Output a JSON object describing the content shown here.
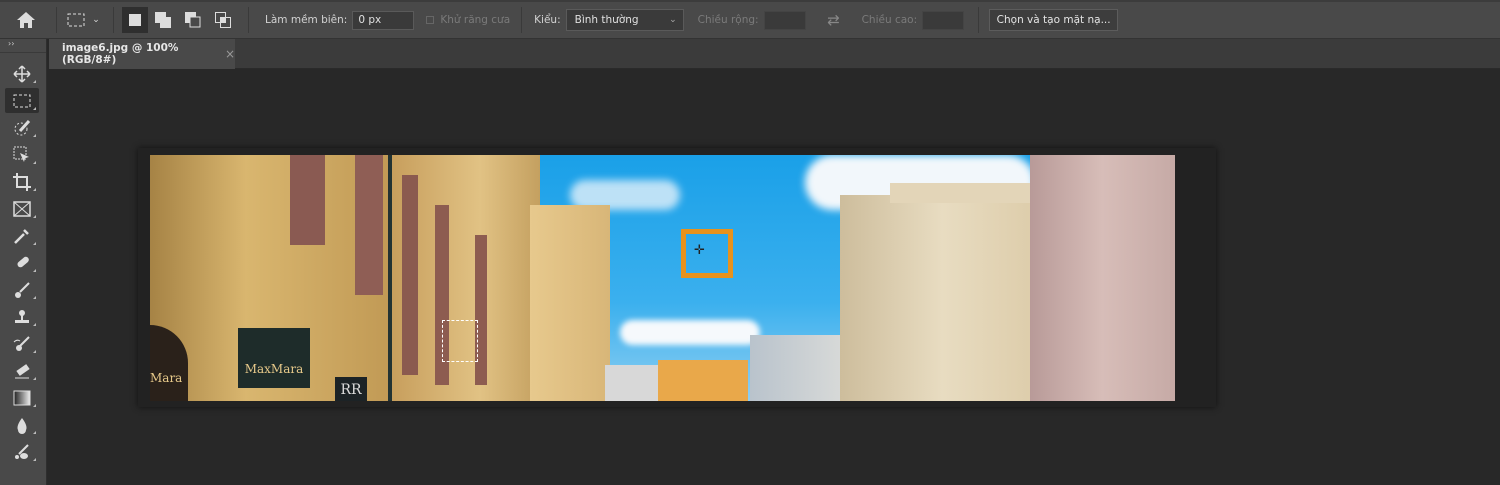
{
  "options_bar": {
    "feather_label": "Làm mềm biên:",
    "feather_value": "0 px",
    "antialias_label": "Khử răng cưa",
    "style_label": "Kiểu:",
    "style_value": "Bình thường",
    "width_label": "Chiều rộng:",
    "height_label": "Chiều cao:",
    "select_mask_button": "Chọn và tạo mặt nạ..."
  },
  "document_tab": {
    "title": "image6.jpg @ 100% (RGB/8#)",
    "close": "×"
  },
  "panel_collapse": "››",
  "tools": [
    "move",
    "rectangular-marquee",
    "quick-selection",
    "object-selection",
    "crop",
    "frame",
    "eyedropper",
    "spot-healing",
    "brush",
    "clone-stamp",
    "history-brush",
    "eraser",
    "gradient",
    "blur",
    "dodge"
  ],
  "canvas": {
    "sign_text": "MaxMara",
    "sign_text2": "Mara",
    "sign_text3": "RR",
    "highlight_color": "#e8921c"
  }
}
